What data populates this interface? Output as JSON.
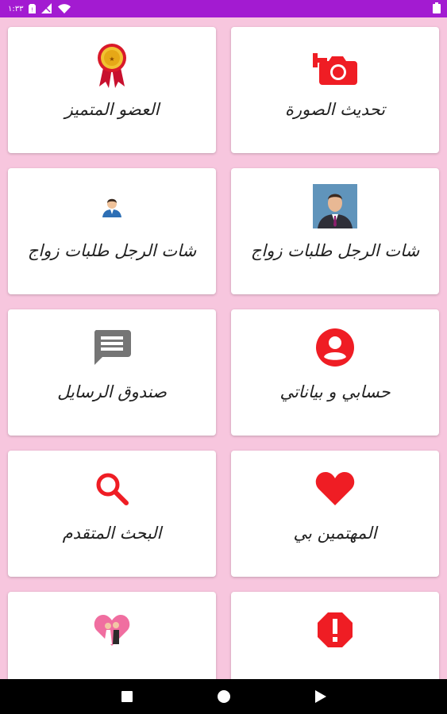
{
  "status_bar": {
    "time": "١:٣٣",
    "background": "#a31bd1"
  },
  "menu": {
    "accent": "#ef1d24",
    "tiles": [
      {
        "label": "تحديث الصورة",
        "icon": "camera-add-icon"
      },
      {
        "label": "العضو المتميز",
        "icon": "award-ribbon-icon"
      },
      {
        "label": "شات الرجل طلبات زواج",
        "icon": "man-photo-icon"
      },
      {
        "label": "شات الرجل طلبات زواج",
        "icon": "man-avatar-icon"
      },
      {
        "label": "حسابي و بياناتي",
        "icon": "account-circle-icon"
      },
      {
        "label": "صندوق الرسايل",
        "icon": "message-icon"
      },
      {
        "label": "المهتمين بي",
        "icon": "heart-icon"
      },
      {
        "label": "البحث المتقدم",
        "icon": "search-icon"
      },
      {
        "label": "",
        "icon": "report-icon"
      },
      {
        "label": "",
        "icon": "wedding-couple-icon"
      }
    ]
  },
  "navigation_bar": {
    "buttons": [
      "recents-button",
      "home-button",
      "back-button"
    ]
  }
}
